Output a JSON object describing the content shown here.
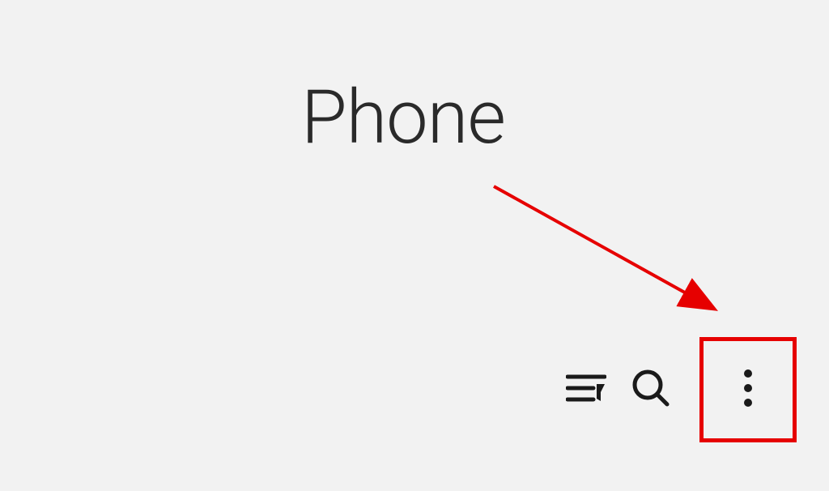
{
  "header": {
    "title": "Phone"
  },
  "toolbar": {
    "filter_label": "Filter",
    "search_label": "Search",
    "more_label": "More options"
  },
  "annotation": {
    "highlight_color": "#e60000"
  }
}
